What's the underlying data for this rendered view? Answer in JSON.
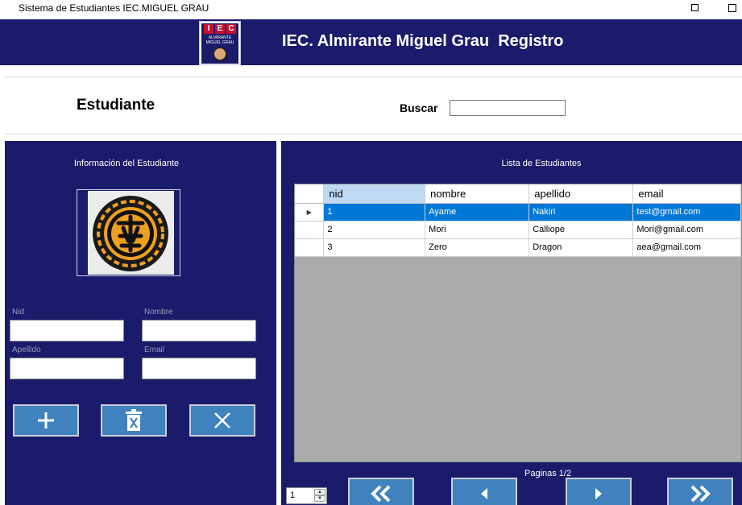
{
  "window": {
    "title": "Sistema de Estudiantes IEC.MIGUEL GRAU"
  },
  "header": {
    "title": "IEC. Almirante Miguel Grau  Registro",
    "logo": {
      "letters": [
        "I",
        "E",
        "C"
      ],
      "line1": "ALMIRANTE",
      "line2": "MIGUEL GRAU"
    }
  },
  "search_strip": {
    "heading": "Estudiante",
    "search_label": "Buscar",
    "search_value": ""
  },
  "student_panel": {
    "title": "Información del Estudiante",
    "photo": "emblem",
    "fields": {
      "nid": {
        "label": "Nid",
        "value": ""
      },
      "nombre": {
        "label": "Nombre",
        "value": ""
      },
      "apellido": {
        "label": "Apellido",
        "value": ""
      },
      "email": {
        "label": "Email",
        "value": ""
      }
    },
    "buttons": {
      "add": "plus-icon",
      "delete": "trash-icon",
      "cancel": "close-icon"
    }
  },
  "list_panel": {
    "title": "Lista de Estudiantes",
    "columns": [
      "nid",
      "nombre",
      "apellido",
      "email"
    ],
    "sorted_column": "nid",
    "rows": [
      {
        "nid": "1",
        "nombre": "Ayame",
        "apellido": "Nakiri",
        "email": "test@gmail.com",
        "selected": true
      },
      {
        "nid": "2",
        "nombre": "Mori",
        "apellido": "Calliope",
        "email": "Mori@gmail.com",
        "selected": false
      },
      {
        "nid": "3",
        "nombre": "Zero",
        "apellido": "Dragon",
        "email": "aea@gmail.com",
        "selected": false
      }
    ],
    "pagination": {
      "label": "Paginas 1/2",
      "page_value": "1",
      "buttons": [
        "first-page-icon",
        "previous-page-icon",
        "next-page-icon",
        "last-page-icon"
      ]
    }
  },
  "colors": {
    "navy": "#1b1b6b",
    "button_blue": "#3f82bd",
    "selection_blue": "#0078d7",
    "sorted_header": "#bfd9f2",
    "emblem_gold": "#f0a020"
  }
}
